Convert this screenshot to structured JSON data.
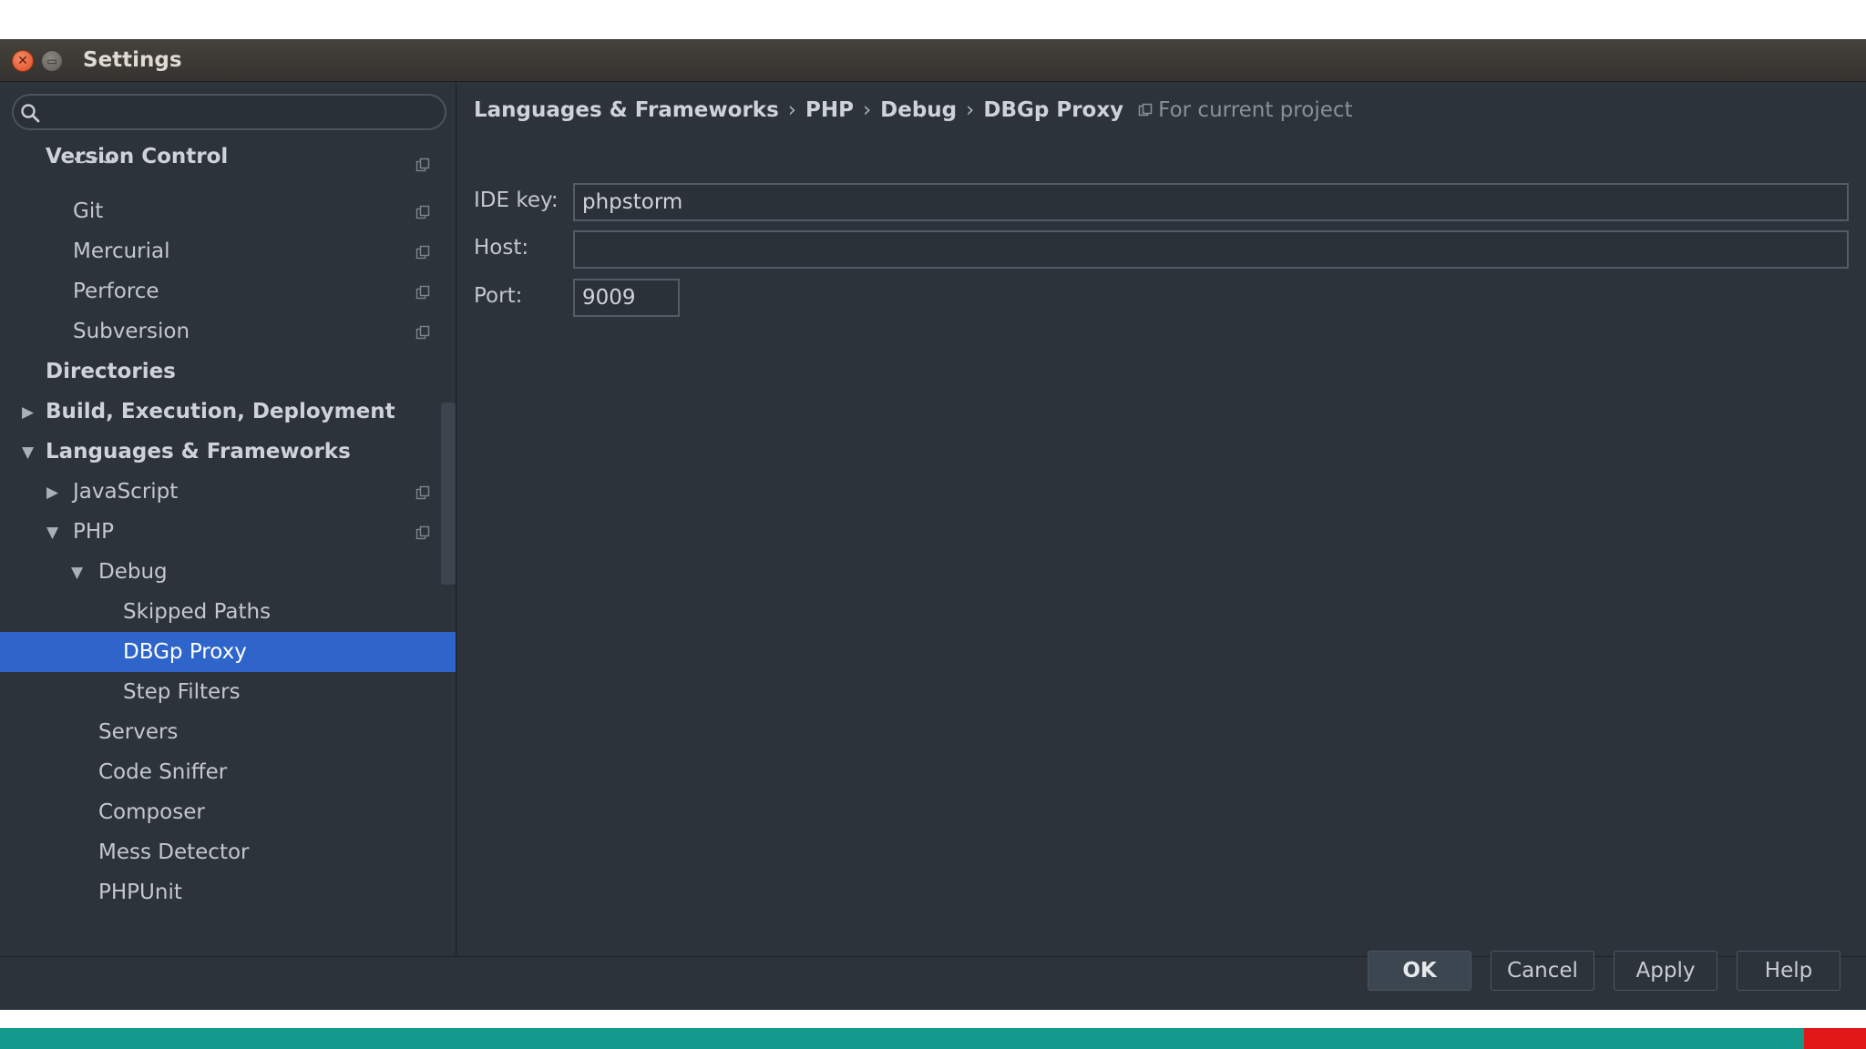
{
  "window": {
    "title": "Settings"
  },
  "search": {
    "placeholder": "",
    "value": ""
  },
  "tree": [
    {
      "label": "Version Control",
      "level": 0,
      "bold": true,
      "arrow": "",
      "proj": false,
      "selected": false
    },
    {
      "label": "CVS",
      "level": 1,
      "bold": false,
      "arrow": "",
      "proj": true,
      "selected": false
    },
    {
      "label": "Git",
      "level": 1,
      "bold": false,
      "arrow": "",
      "proj": true,
      "selected": false
    },
    {
      "label": "Mercurial",
      "level": 1,
      "bold": false,
      "arrow": "",
      "proj": true,
      "selected": false
    },
    {
      "label": "Perforce",
      "level": 1,
      "bold": false,
      "arrow": "",
      "proj": true,
      "selected": false
    },
    {
      "label": "Subversion",
      "level": 1,
      "bold": false,
      "arrow": "",
      "proj": true,
      "selected": false
    },
    {
      "label": "Directories",
      "level": 0,
      "bold": true,
      "arrow": "",
      "proj": false,
      "selected": false
    },
    {
      "label": "Build, Execution, Deployment",
      "level": 0,
      "bold": true,
      "arrow": "right",
      "proj": false,
      "selected": false
    },
    {
      "label": "Languages & Frameworks",
      "level": 0,
      "bold": true,
      "arrow": "down",
      "proj": false,
      "selected": false
    },
    {
      "label": "JavaScript",
      "level": 1,
      "bold": false,
      "arrow": "right",
      "proj": true,
      "selected": false
    },
    {
      "label": "PHP",
      "level": 1,
      "bold": false,
      "arrow": "down",
      "proj": true,
      "selected": false
    },
    {
      "label": "Debug",
      "level": 2,
      "bold": false,
      "arrow": "down",
      "proj": false,
      "selected": false
    },
    {
      "label": "Skipped Paths",
      "level": 3,
      "bold": false,
      "arrow": "",
      "proj": false,
      "selected": false
    },
    {
      "label": "DBGp Proxy",
      "level": 3,
      "bold": false,
      "arrow": "",
      "proj": false,
      "selected": true
    },
    {
      "label": "Step Filters",
      "level": 3,
      "bold": false,
      "arrow": "",
      "proj": false,
      "selected": false
    },
    {
      "label": "Servers",
      "level": 2,
      "bold": false,
      "arrow": "",
      "proj": false,
      "selected": false
    },
    {
      "label": "Code Sniffer",
      "level": 2,
      "bold": false,
      "arrow": "",
      "proj": false,
      "selected": false
    },
    {
      "label": "Composer",
      "level": 2,
      "bold": false,
      "arrow": "",
      "proj": false,
      "selected": false
    },
    {
      "label": "Mess Detector",
      "level": 2,
      "bold": false,
      "arrow": "",
      "proj": false,
      "selected": false
    },
    {
      "label": "PHPUnit",
      "level": 2,
      "bold": false,
      "arrow": "",
      "proj": false,
      "selected": false
    }
  ],
  "breadcrumb": {
    "parts": [
      "Languages & Frameworks",
      "PHP",
      "Debug",
      "DBGp Proxy"
    ],
    "separator": "›",
    "scope": "For current project"
  },
  "form": {
    "ide_key": {
      "label": "IDE key:",
      "value": "phpstorm"
    },
    "host": {
      "label": "Host:",
      "value": ""
    },
    "port": {
      "label": "Port:",
      "value": "9009"
    }
  },
  "buttons": {
    "ok": "OK",
    "cancel": "Cancel",
    "apply": "Apply",
    "help": "Help"
  },
  "colors": {
    "background": "#2c333b",
    "selection": "#2f65ca",
    "taskbar_teal": "#149a8d",
    "taskbar_red": "#e01818"
  },
  "icons": {
    "close": "close-icon",
    "minimize": "minimize-icon",
    "search": "search-icon",
    "project_scope": "project-scope-icon"
  }
}
